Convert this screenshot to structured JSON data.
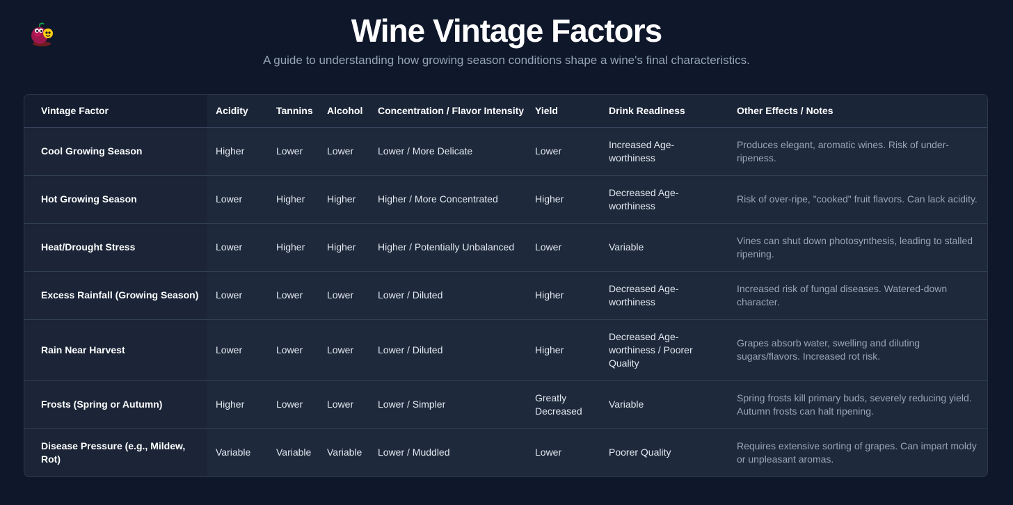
{
  "header": {
    "title": "Wine Vintage Factors",
    "subtitle": "A guide to understanding how growing season conditions shape a wine's final characteristics."
  },
  "colors": {
    "background": "#0f172a",
    "card": "#1e293b",
    "notes_text": "#9aa5b6",
    "logo_primary": "#be185d",
    "logo_secondary": "#facc15"
  },
  "logo": {
    "icon": "wine-grape-mascot-icon"
  },
  "table": {
    "headers": [
      "Vintage Factor",
      "Acidity",
      "Tannins",
      "Alcohol",
      "Concentration / Flavor Intensity",
      "Yield",
      "Drink Readiness",
      "Other Effects / Notes"
    ],
    "rows": [
      [
        "Cool Growing Season",
        "Higher",
        "Lower",
        "Lower",
        "Lower / More Delicate",
        "Lower",
        "Increased Age-worthiness",
        "Produces elegant, aromatic wines. Risk of under-ripeness."
      ],
      [
        "Hot Growing Season",
        "Lower",
        "Higher",
        "Higher",
        "Higher / More Concentrated",
        "Higher",
        "Decreased Age-worthiness",
        "Risk of over-ripe, \"cooked\" fruit flavors. Can lack acidity."
      ],
      [
        "Heat/Drought Stress",
        "Lower",
        "Higher",
        "Higher",
        "Higher / Potentially Unbalanced",
        "Lower",
        "Variable",
        "Vines can shut down photosynthesis, leading to stalled ripening."
      ],
      [
        "Excess Rainfall (Growing Season)",
        "Lower",
        "Lower",
        "Lower",
        "Lower / Diluted",
        "Higher",
        "Decreased Age-worthiness",
        "Increased risk of fungal diseases. Watered-down character."
      ],
      [
        "Rain Near Harvest",
        "Lower",
        "Lower",
        "Lower",
        "Lower / Diluted",
        "Higher",
        "Decreased Age-worthiness / Poorer Quality",
        "Grapes absorb water, swelling and diluting sugars/flavors. Increased rot risk."
      ],
      [
        "Frosts (Spring or Autumn)",
        "Higher",
        "Lower",
        "Lower",
        "Lower / Simpler",
        "Greatly Decreased",
        "Variable",
        "Spring frosts kill primary buds, severely reducing yield. Autumn frosts can halt ripening."
      ],
      [
        "Disease Pressure (e.g., Mildew, Rot)",
        "Variable",
        "Variable",
        "Variable",
        "Lower / Muddled",
        "Lower",
        "Poorer Quality",
        "Requires extensive sorting of grapes. Can impart moldy or unpleasant aromas."
      ]
    ]
  }
}
